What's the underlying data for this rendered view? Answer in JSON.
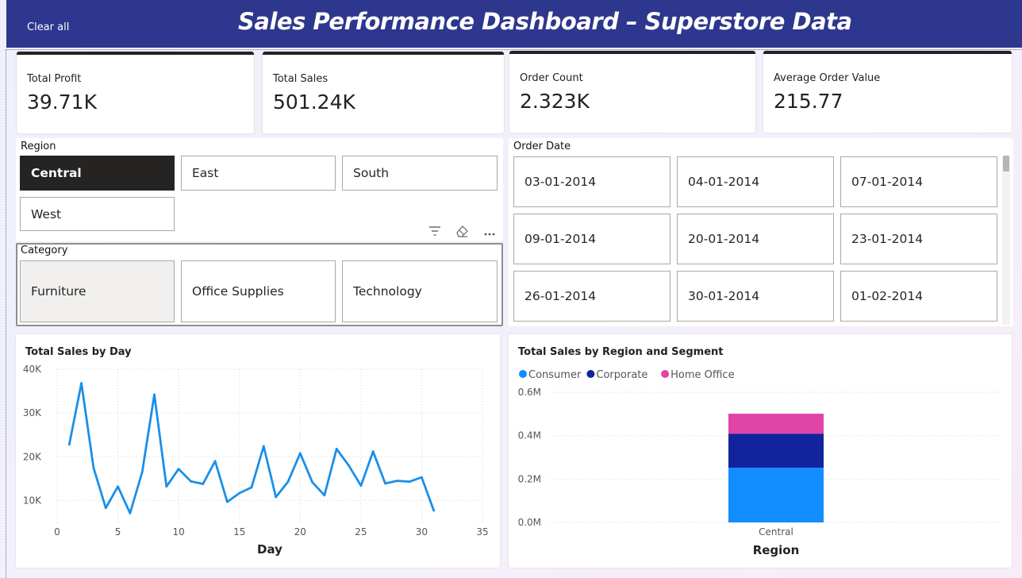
{
  "header": {
    "title": "Sales Performance Dashboard – Superstore Data",
    "clear_label": "Clear all"
  },
  "kpis": [
    {
      "label": "Total Profit",
      "value": "39.71K"
    },
    {
      "label": "Total Sales",
      "value": "501.24K"
    },
    {
      "label": "Order Count",
      "value": "2.323K"
    },
    {
      "label": "Average Order Value",
      "value": "215.77"
    }
  ],
  "region_slicer": {
    "title": "Region",
    "items": [
      "Central",
      "East",
      "South",
      "West"
    ],
    "selected": "Central"
  },
  "category_slicer": {
    "title": "Category",
    "items": [
      "Furniture",
      "Office Supplies",
      "Technology"
    ],
    "hovered": "Furniture"
  },
  "visual_header_icons": [
    "filter-icon",
    "eraser-icon",
    "more-options-icon"
  ],
  "date_slicer": {
    "title": "Order Date",
    "items": [
      "03-01-2014",
      "04-01-2014",
      "07-01-2014",
      "09-01-2014",
      "20-01-2014",
      "23-01-2014",
      "26-01-2014",
      "30-01-2014",
      "01-02-2014"
    ]
  },
  "colors": {
    "header_bg": "#2d378e",
    "line": "#1a8fe8",
    "consumer": "#118dff",
    "corporate": "#12239e",
    "home_office": "#e044a7"
  },
  "chart_data": [
    {
      "type": "line",
      "title": "Total Sales by Day",
      "xlabel": "Day",
      "ylabel": "",
      "xlim": [
        0,
        35
      ],
      "ylim": [
        5000,
        40000
      ],
      "x_ticks": [
        0,
        5,
        10,
        15,
        20,
        25,
        30,
        35
      ],
      "y_ticks": [
        10000,
        20000,
        30000,
        40000
      ],
      "y_tick_labels": [
        "10K",
        "20K",
        "30K",
        "40K"
      ],
      "grid": true,
      "x": [
        1,
        2,
        3,
        4,
        5,
        6,
        7,
        8,
        9,
        10,
        11,
        12,
        13,
        14,
        15,
        16,
        17,
        18,
        19,
        20,
        21,
        22,
        23,
        24,
        25,
        26,
        27,
        28,
        29,
        30,
        31
      ],
      "values": [
        22800,
        36800,
        17500,
        8300,
        13200,
        7100,
        16500,
        34200,
        13200,
        17200,
        14400,
        13800,
        19000,
        9700,
        11700,
        13000,
        22400,
        10800,
        14300,
        20800,
        14200,
        11200,
        21800,
        18000,
        13400,
        21200,
        13900,
        14500,
        14300,
        15300,
        7700
      ]
    },
    {
      "type": "bar",
      "stacked": true,
      "title": "Total Sales by Region and Segment",
      "xlabel": "Region",
      "ylabel": "",
      "categories": [
        "Central"
      ],
      "ylim": [
        0,
        600000
      ],
      "y_ticks": [
        0,
        200000,
        400000,
        600000
      ],
      "y_tick_labels": [
        "0.0M",
        "0.2M",
        "0.4M",
        "0.6M"
      ],
      "legend_position": "top-left",
      "series": [
        {
          "name": "Consumer",
          "values": [
            252000
          ]
        },
        {
          "name": "Corporate",
          "values": [
            157000
          ]
        },
        {
          "name": "Home Office",
          "values": [
            92000
          ]
        }
      ]
    }
  ]
}
